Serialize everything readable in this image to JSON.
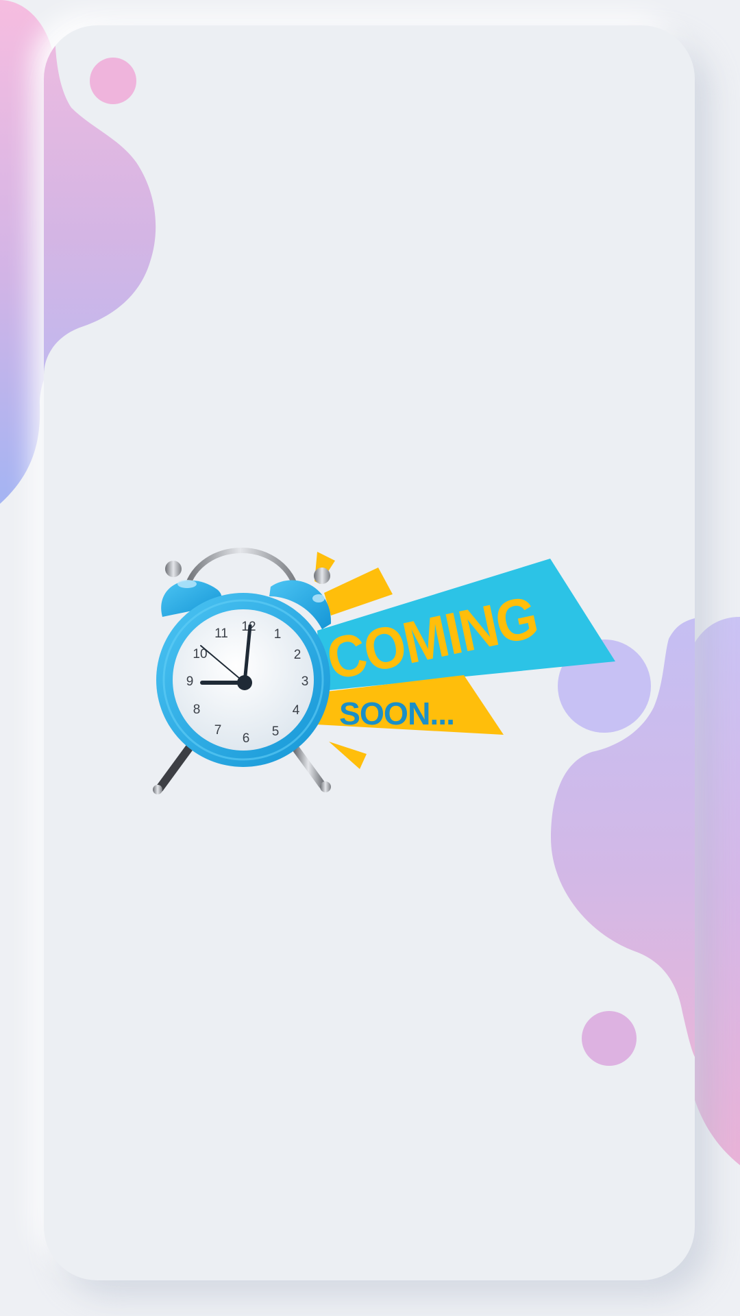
{
  "screen": {
    "background_color": "#eef0f4",
    "card_color": "#eceff3"
  },
  "illustration": {
    "name": "alarm-clock-coming-soon",
    "headline": "COMING",
    "subline": "SOON...",
    "clock_numbers": [
      "12",
      "1",
      "2",
      "3",
      "4",
      "5",
      "6",
      "7",
      "8",
      "9",
      "10",
      "11"
    ],
    "time_shown": "9:00",
    "colors": {
      "clock_blue": "#27aee6",
      "banner_cyan": "#2cc3e6",
      "banner_yellow": "#ffbf0a",
      "subline_blue": "#1a8fc7",
      "blob_pink": "#f5b8df",
      "blob_violet": "#c9c1f4"
    }
  }
}
